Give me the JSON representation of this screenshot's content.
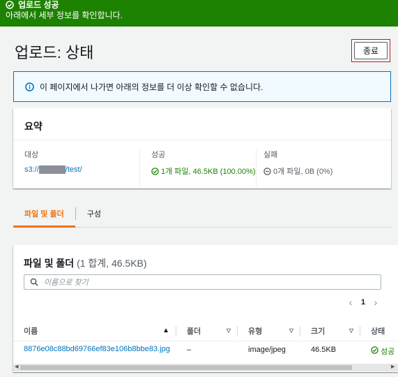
{
  "flash": {
    "title": "업로드 성공",
    "message": "아래에서 세부 정보를 확인합니다."
  },
  "header": {
    "title": "업로드: 상태",
    "close_label": "종료"
  },
  "info": {
    "message": "이 페이지에서 나가면 아래의 정보를 더 이상 확인할 수 없습니다."
  },
  "summary": {
    "title": "요약",
    "destination_label": "대상",
    "destination_prefix": "s3://",
    "destination_suffix": "/test/",
    "success_label": "성공",
    "success_value": "1개 파일, 46.5KB (100.00%)",
    "failed_label": "실패",
    "failed_value": "0개 파일, 0B (0%)"
  },
  "tabs": [
    {
      "label": "파일 및 폴더",
      "active": true
    },
    {
      "label": "구성",
      "active": false
    }
  ],
  "files": {
    "title": "파일 및 폴더",
    "count": "(1 합계, 46.5KB)",
    "search_placeholder": "이름으로 찾기",
    "page": "1",
    "columns": [
      "이름",
      "폴더",
      "유형",
      "크기",
      "상태"
    ],
    "rows": [
      {
        "name": "8876e08c88bd69766ef83e106b8bbe83.jpg",
        "folder": "–",
        "type": "image/jpeg",
        "size": "46.5KB",
        "status": "성공"
      }
    ]
  },
  "colors": {
    "success": "#1d8102",
    "link": "#0073bb",
    "accent": "#ec7211",
    "info_border": "#0073bb"
  }
}
